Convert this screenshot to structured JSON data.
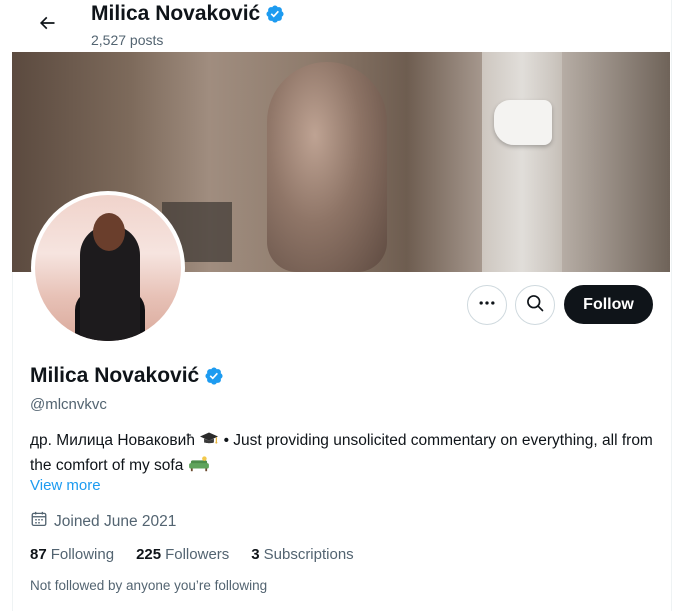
{
  "header": {
    "name": "Milica Novaković",
    "posts": "2,527 posts"
  },
  "profile": {
    "name": "Milica Novaković",
    "handle": "@mlcnvkvc",
    "bio_part1": "др. Милица Новаковић",
    "bio_part2": "• Just providing unsolicited commentary on everything, all from the comfort of my sofa",
    "view_more": "View more",
    "joined": "Joined June 2021",
    "stats": [
      {
        "count": "87",
        "label": "Following"
      },
      {
        "count": "225",
        "label": "Followers"
      },
      {
        "count": "3",
        "label": "Subscriptions"
      }
    ],
    "not_followed": "Not followed by anyone you’re following"
  },
  "actions": {
    "follow_label": "Follow"
  },
  "icons": {
    "back": "arrow-left-icon",
    "verified": "verified-badge-icon",
    "more": "more-horizontal-icon",
    "search": "search-icon",
    "calendar": "calendar-icon",
    "grad_cap": "graduation-cap-emoji",
    "sofa": "sofa-emoji"
  },
  "colors": {
    "accent": "#1d9bf0",
    "text": "#0f1419",
    "secondary": "#536471"
  }
}
